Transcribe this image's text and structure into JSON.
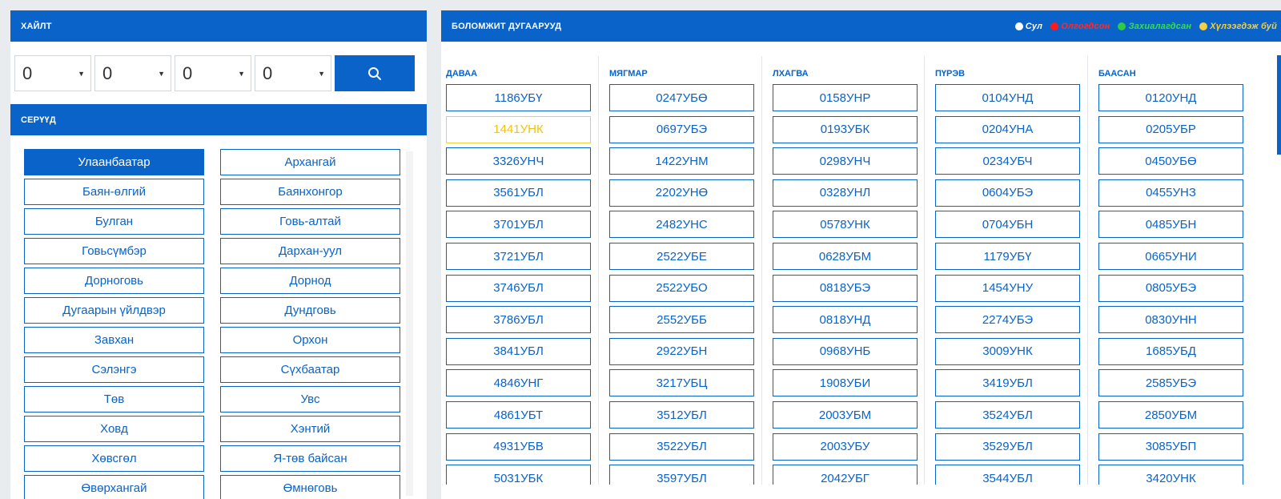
{
  "search": {
    "title": "ХАЙЛТ",
    "selects": [
      "0",
      "0",
      "0",
      "0"
    ],
    "button_icon": "search-icon"
  },
  "series": {
    "title": "СЕРҮҮД",
    "cities": [
      "Улаанбаатар",
      "Архангай",
      "Баян-өлгий",
      "Баянхонгор",
      "Булган",
      "Говь-алтай",
      "Говьсүмбэр",
      "Дархан-уул",
      "Дорноговь",
      "Дорнод",
      "Дугаарын үйлдвэр",
      "Дундговь",
      "Завхан",
      "Орхон",
      "Сэлэнгэ",
      "Сүхбаатар",
      "Төв",
      "Увс",
      "Ховд",
      "Хэнтий",
      "Хөвсгөл",
      "Я-төв байсан",
      "Өвөрхангай",
      "Өмнөговь"
    ],
    "active_index": 0
  },
  "numbers": {
    "title": "БОЛОМЖИТ ДУГААРУУД",
    "legend": [
      {
        "label": "Сул",
        "color": "#ffffff",
        "text_color": "#ffffff"
      },
      {
        "label": "Олгогдсон",
        "color": "#ff1a1a",
        "text_color": "#ff2b2b"
      },
      {
        "label": "Захиалагдсан",
        "color": "#2ecc40",
        "text_color": "#34e04a"
      },
      {
        "label": "Хүлээгдэж буй",
        "color": "#f4d03f",
        "text_color": "#f4d03f"
      }
    ],
    "days": [
      {
        "name": "ДАВАА",
        "items": [
          "1186УБҮ",
          "1441УНК",
          "3326УНЧ",
          "3561УБЛ",
          "3701УБЛ",
          "3721УБЛ",
          "3746УБЛ",
          "3786УБЛ",
          "3841УБЛ",
          "4846УНГ",
          "4861УБТ",
          "4931УБВ",
          "5031УБК"
        ]
      },
      {
        "name": "МЯГМАР",
        "items": [
          "0247УБӨ",
          "0697УБЭ",
          "1422УНМ",
          "2202УНӨ",
          "2482УНС",
          "2522УБЕ",
          "2522УБО",
          "2552УББ",
          "2922УБН",
          "3217УБЦ",
          "3512УБЛ",
          "3522УБЛ",
          "3597УБЛ"
        ]
      },
      {
        "name": "ЛХАГВА",
        "items": [
          "0158УНР",
          "0193УБК",
          "0298УНЧ",
          "0328УНЛ",
          "0578УНК",
          "0628УБМ",
          "0818УБЭ",
          "0818УНД",
          "0968УНБ",
          "1908УБИ",
          "2003УБМ",
          "2003УБУ",
          "2042УБГ"
        ]
      },
      {
        "name": "ПҮРЭВ",
        "items": [
          "0104УНД",
          "0204УНА",
          "0234УБЧ",
          "0604УБЭ",
          "0704УБН",
          "1179УБҮ",
          "1454УНУ",
          "2274УБЭ",
          "3009УНК",
          "3419УБЛ",
          "3524УБЛ",
          "3529УБЛ",
          "3544УБЛ"
        ]
      },
      {
        "name": "БААСАН",
        "items": [
          "0120УНД",
          "0205УБР",
          "0450УБӨ",
          "0455УНЗ",
          "0485УБН",
          "0665УНИ",
          "0805УБЭ",
          "0830УНН",
          "1685УБД",
          "2585УБЭ",
          "2850УБМ",
          "3085УБП",
          "3420УНК"
        ]
      }
    ],
    "pending_item": {
      "day": 0,
      "index": 1
    }
  }
}
